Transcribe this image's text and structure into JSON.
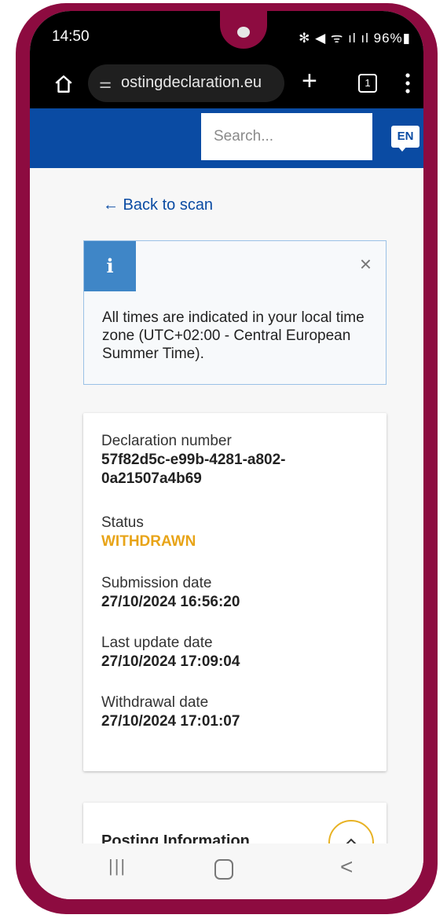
{
  "status_bar": {
    "time": "14:50",
    "right_icons": "✻ ◀ ᯤ ıl ıl",
    "battery": "96%"
  },
  "browser": {
    "url": "ostingdeclaration.eu",
    "tab_count": "1",
    "home_icon": "home-icon",
    "site_info_icon": "tune-icon",
    "new_tab_label": "+",
    "menu_icon": "three-dots-icon"
  },
  "header": {
    "search_placeholder": "Search...",
    "language": "EN",
    "color": "#0a4ba3"
  },
  "main": {
    "back_link": "← Back to scan",
    "info": {
      "icon_letter": "i",
      "close_label": "×",
      "message": "All times are indicated in your local time zone (UTC+02:00 - Central European Summer Time)."
    },
    "details": [
      {
        "label": "Declaration number",
        "value": "57f82d5c-e99b-4281-a802-\n0a21507a4b69"
      },
      {
        "label": "Status",
        "value": "WITHDRAWN"
      },
      {
        "label": "Submission date",
        "value": "27/10/2024 16:56:20"
      },
      {
        "label": "Last update date",
        "value": "27/10/2024 17:09:04"
      },
      {
        "label": "Withdrawal date",
        "value": "27/10/2024 17:01:07"
      }
    ],
    "status_color": "#e8a418",
    "posting_title": "Posting Information"
  },
  "nav_bar": {
    "recent": "|||",
    "back": "<"
  }
}
